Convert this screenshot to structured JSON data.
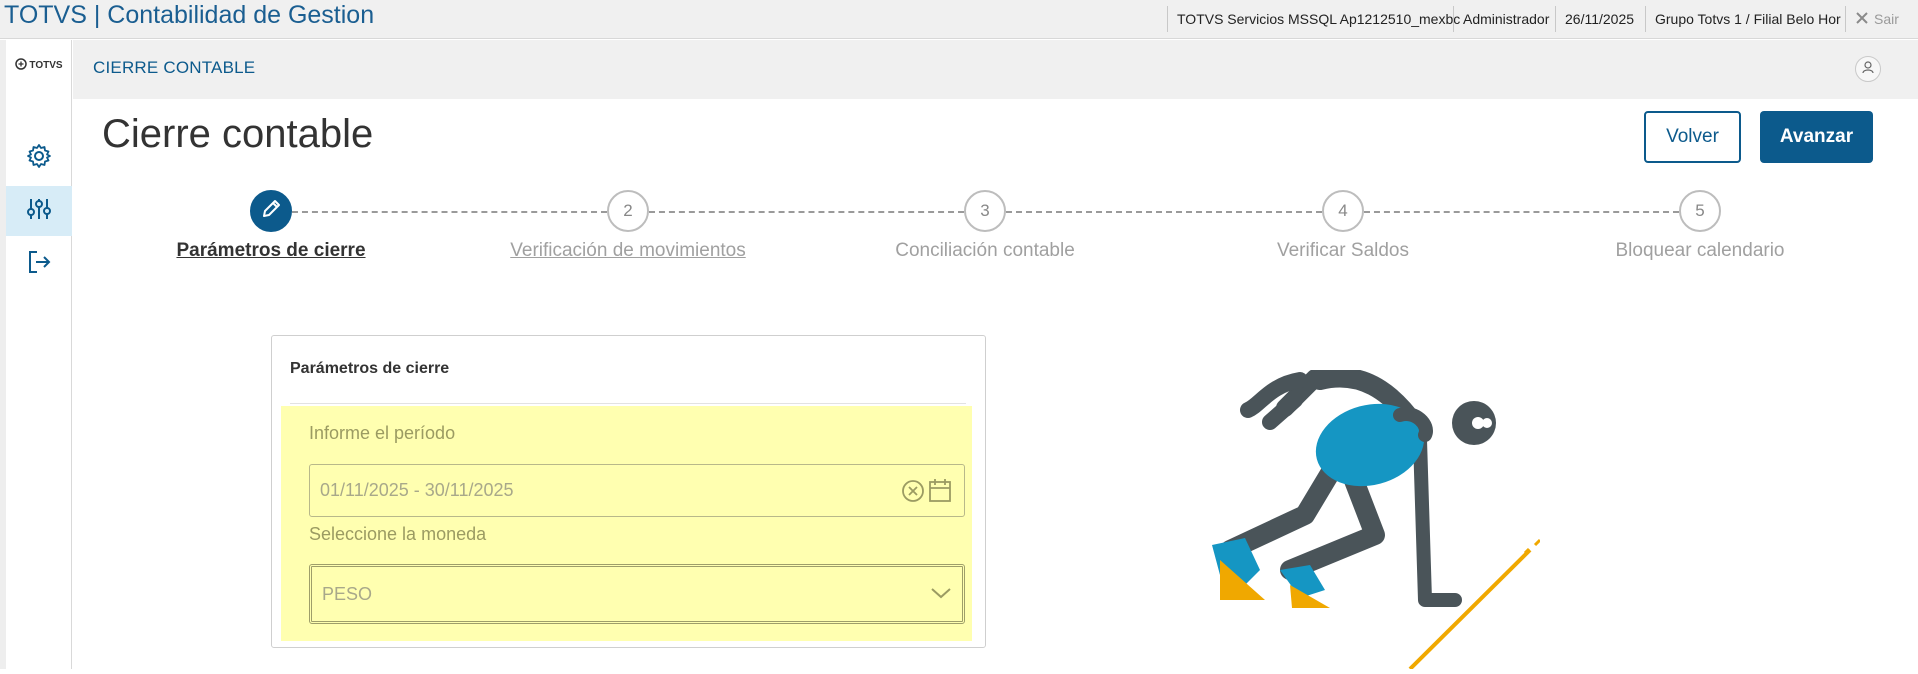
{
  "topbar": {
    "app_title": "TOTVS | Contabilidad de Gestion",
    "server": "TOTVS Servicios MSSQL Ap1212510_mexbc",
    "user": "Administrador",
    "date": "26/11/2025",
    "branch": "Grupo Totvs 1 / Filial Belo Hor",
    "exit_label": "Sair"
  },
  "sidebar": {
    "brand": "TOTVS",
    "items": [
      {
        "icon": "gear-icon"
      },
      {
        "icon": "sliders-icon",
        "active": true
      },
      {
        "icon": "logout-icon"
      }
    ]
  },
  "header": {
    "module_title": "CIERRE CONTABLE"
  },
  "page": {
    "title": "Cierre contable",
    "back_label": "Volver",
    "next_label": "Avanzar"
  },
  "stepper": {
    "steps": [
      {
        "number": "",
        "label": "Parámetros de cierre",
        "state": "current"
      },
      {
        "number": "2",
        "label": "Verificación de movimientos",
        "state": "link"
      },
      {
        "number": "3",
        "label": "Conciliación contable",
        "state": "pending"
      },
      {
        "number": "4",
        "label": "Verificar Saldos",
        "state": "pending"
      },
      {
        "number": "5",
        "label": "Bloquear calendario",
        "state": "pending"
      }
    ]
  },
  "card": {
    "title": "Parámetros de cierre",
    "period_label": "Informe el período",
    "period_value": "01/11/2025 - 30/11/2025",
    "currency_label": "Seleccione la moneda",
    "currency_value": "PESO"
  },
  "colors": {
    "brand_blue": "#0c5a8c",
    "highlight": "#ffffb0",
    "figure_body": "#4a5459",
    "figure_shirt": "#1596c3",
    "figure_shoe": "#f0a800"
  }
}
